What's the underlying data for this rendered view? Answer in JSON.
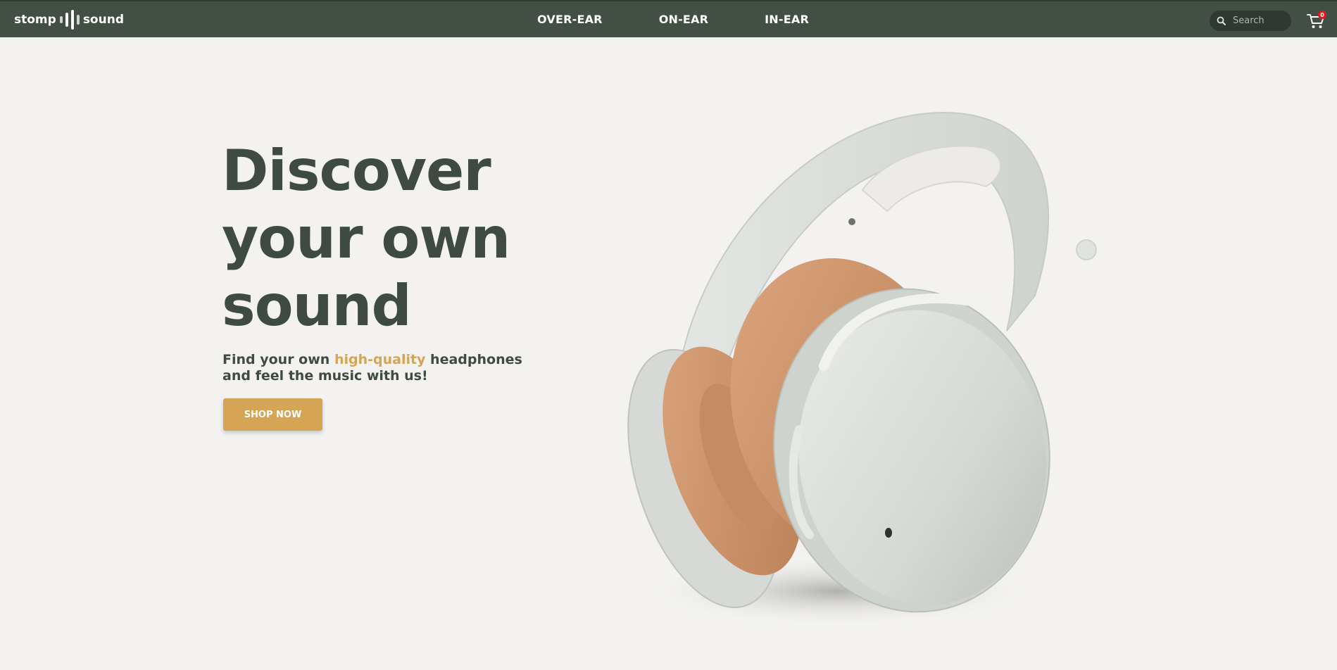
{
  "brand": {
    "left": "stomp",
    "right": "sound"
  },
  "nav": {
    "items": [
      "OVER-EAR",
      "ON-EAR",
      "IN-EAR"
    ]
  },
  "search": {
    "placeholder": "Search"
  },
  "cart": {
    "count": "0"
  },
  "hero": {
    "title_lines": [
      "Discover",
      "your own",
      "sound"
    ],
    "subtitle_before": "Find your own ",
    "subtitle_highlight": "high-quality",
    "subtitle_after": " headphones and feel the music with us!",
    "cta": "SHOP NOW"
  },
  "colors": {
    "nav_bg": "#434f45",
    "page_bg": "#f3f2f0",
    "heading": "#3f4b41",
    "accent": "#d6a455",
    "badge": "#e01b1b"
  },
  "icons": [
    "search-icon",
    "cart-icon",
    "headphones-image"
  ]
}
